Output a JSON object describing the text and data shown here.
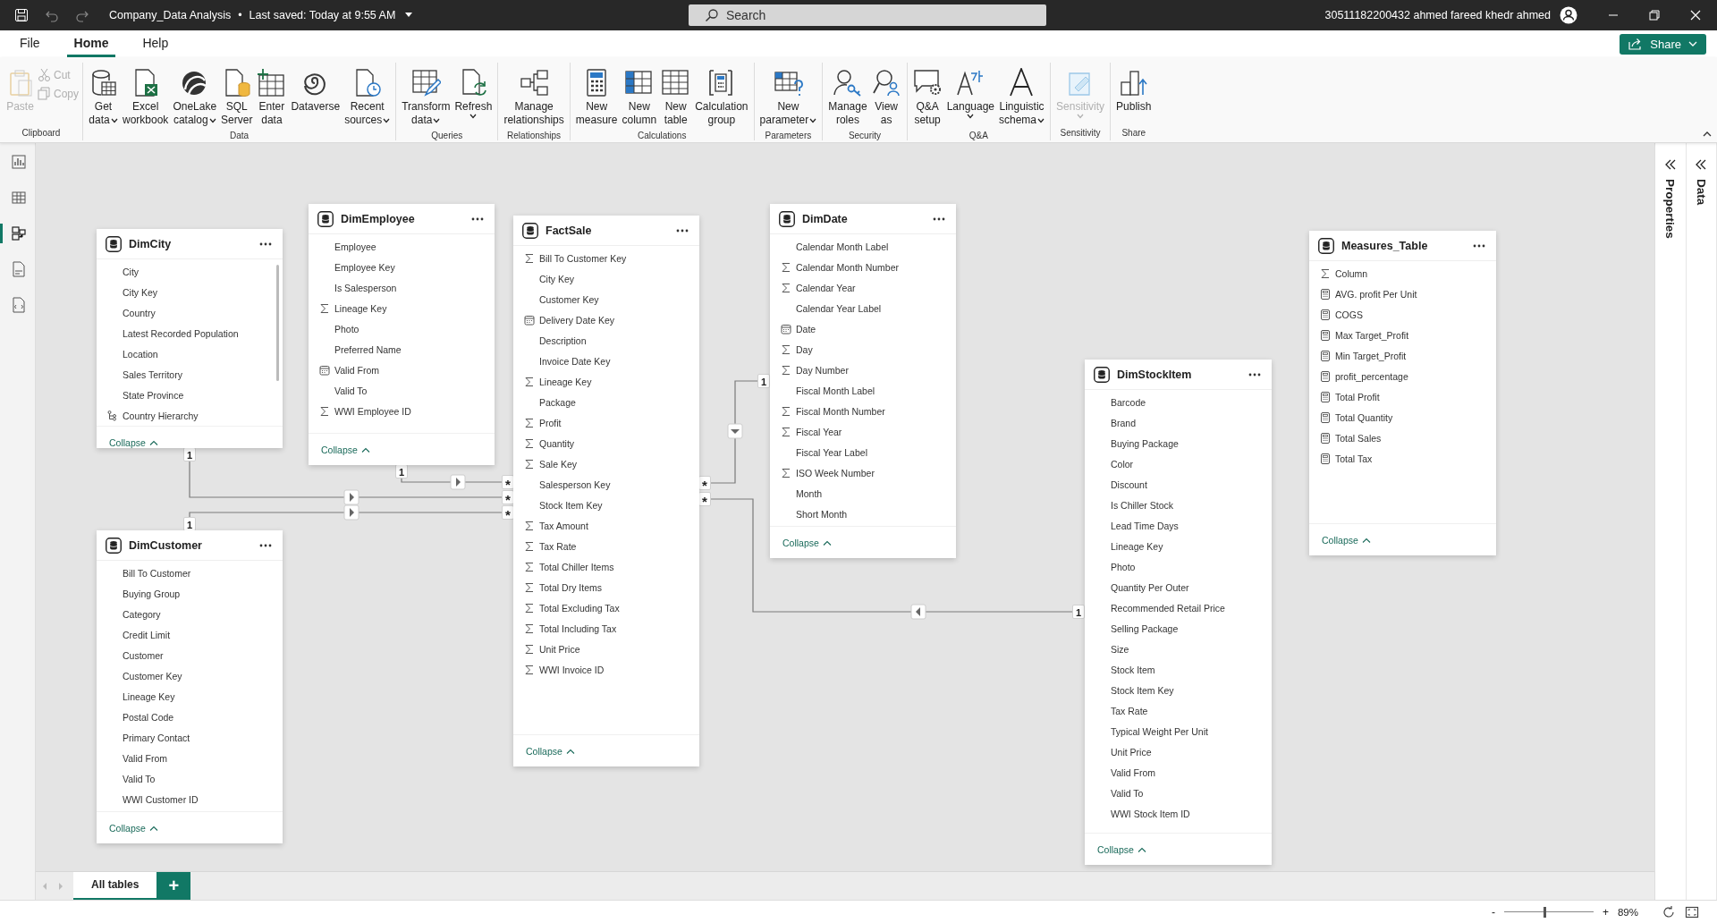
{
  "title_bar": {
    "file_name": "Company_Data Analysis",
    "separator": "•",
    "saved": "Last saved: Today at 9:55 AM",
    "search": {
      "placeholder": "Search"
    },
    "user": "30511182200432 ahmed fareed khedr ahmed"
  },
  "menu_tabs": [
    {
      "label": "File",
      "selected": false
    },
    {
      "label": "Home",
      "selected": true
    },
    {
      "label": "Help",
      "selected": false
    }
  ],
  "share_button": "Share",
  "ribbon": {
    "groups": [
      {
        "label": "Clipboard",
        "buttons": [
          {
            "lines": [
              "Paste"
            ],
            "kind": "large",
            "dropdown": false,
            "disabled": true
          },
          {
            "lines": [
              "Cut"
            ],
            "kind": "small",
            "disabled": true
          },
          {
            "lines": [
              "Copy"
            ],
            "kind": "small",
            "disabled": true
          }
        ]
      },
      {
        "label": "Data",
        "buttons": [
          {
            "lines": [
              "Get",
              "data"
            ],
            "kind": "large",
            "dropdown": true,
            "disabled": false
          },
          {
            "lines": [
              "Excel",
              "workbook"
            ],
            "kind": "large",
            "dropdown": false,
            "disabled": false
          },
          {
            "lines": [
              "OneLake",
              "catalog"
            ],
            "kind": "large",
            "dropdown": true,
            "disabled": false
          },
          {
            "lines": [
              "SQL",
              "Server"
            ],
            "kind": "large",
            "dropdown": false,
            "disabled": false
          },
          {
            "lines": [
              "Enter",
              "data"
            ],
            "kind": "large",
            "dropdown": false,
            "disabled": false
          },
          {
            "lines": [
              "Dataverse"
            ],
            "kind": "large",
            "dropdown": false,
            "disabled": false
          },
          {
            "lines": [
              "Recent",
              "sources"
            ],
            "kind": "large",
            "dropdown": true,
            "disabled": false
          }
        ]
      },
      {
        "label": "Queries",
        "buttons": [
          {
            "lines": [
              "Transform",
              "data"
            ],
            "kind": "large",
            "dropdown": true,
            "disabled": false
          },
          {
            "lines": [
              "Refresh"
            ],
            "kind": "large",
            "dropdown": true,
            "disabled": false
          }
        ]
      },
      {
        "label": "Relationships",
        "buttons": [
          {
            "lines": [
              "Manage",
              "relationships"
            ],
            "kind": "large",
            "dropdown": false,
            "disabled": false
          }
        ]
      },
      {
        "label": "Calculations",
        "buttons": [
          {
            "lines": [
              "New",
              "measure"
            ],
            "kind": "large",
            "dropdown": false,
            "disabled": false
          },
          {
            "lines": [
              "New",
              "column"
            ],
            "kind": "large",
            "dropdown": false,
            "disabled": false
          },
          {
            "lines": [
              "New",
              "table"
            ],
            "kind": "large",
            "dropdown": false,
            "disabled": false
          },
          {
            "lines": [
              "Calculation",
              "group"
            ],
            "kind": "large",
            "dropdown": false,
            "disabled": false
          }
        ]
      },
      {
        "label": "Parameters",
        "buttons": [
          {
            "lines": [
              "New",
              "parameter"
            ],
            "kind": "large",
            "dropdown": true,
            "disabled": false
          }
        ]
      },
      {
        "label": "Security",
        "buttons": [
          {
            "lines": [
              "Manage",
              "roles"
            ],
            "kind": "large",
            "dropdown": false,
            "disabled": false
          },
          {
            "lines": [
              "View",
              "as"
            ],
            "kind": "large",
            "dropdown": false,
            "disabled": false
          }
        ]
      },
      {
        "label": "Q&A",
        "buttons": [
          {
            "lines": [
              "Q&A",
              "setup"
            ],
            "kind": "large",
            "dropdown": false,
            "disabled": false
          },
          {
            "lines": [
              "Language"
            ],
            "kind": "large",
            "dropdown": true,
            "disabled": false
          },
          {
            "lines": [
              "Linguistic",
              "schema"
            ],
            "kind": "large",
            "dropdown": true,
            "disabled": false
          }
        ]
      },
      {
        "label": "Sensitivity",
        "buttons": [
          {
            "lines": [
              "Sensitivity"
            ],
            "kind": "large",
            "dropdown": true,
            "disabled": true
          }
        ]
      },
      {
        "label": "Share",
        "buttons": [
          {
            "lines": [
              "Publish"
            ],
            "kind": "large",
            "dropdown": false,
            "disabled": false
          }
        ]
      }
    ]
  },
  "view_rail": [
    {
      "selected": false
    },
    {
      "selected": false
    },
    {
      "selected": true
    },
    {
      "selected": false
    },
    {
      "selected": false
    }
  ],
  "side_panes": [
    {
      "label": "Properties"
    },
    {
      "label": "Data"
    }
  ],
  "tables": [
    {
      "name": "DimCity",
      "scrollbar": true,
      "collapse": "Collapse",
      "fields": [
        {
          "name": "City",
          "kind": "text"
        },
        {
          "name": "City Key",
          "kind": "text"
        },
        {
          "name": "Country",
          "kind": "text"
        },
        {
          "name": "Latest Recorded Population",
          "kind": "text"
        },
        {
          "name": "Location",
          "kind": "text"
        },
        {
          "name": "Sales Territory",
          "kind": "text"
        },
        {
          "name": "State Province",
          "kind": "text"
        },
        {
          "name": "Country Hierarchy",
          "kind": "hierarchy"
        }
      ]
    },
    {
      "name": "DimEmployee",
      "scrollbar": false,
      "collapse": "Collapse",
      "fields": [
        {
          "name": "Employee",
          "kind": "text"
        },
        {
          "name": "Employee Key",
          "kind": "text"
        },
        {
          "name": "Is Salesperson",
          "kind": "text"
        },
        {
          "name": "Lineage Key",
          "kind": "sum"
        },
        {
          "name": "Photo",
          "kind": "text"
        },
        {
          "name": "Preferred Name",
          "kind": "text"
        },
        {
          "name": "Valid From",
          "kind": "date"
        },
        {
          "name": "Valid To",
          "kind": "text"
        },
        {
          "name": "WWI Employee ID",
          "kind": "sum"
        }
      ]
    },
    {
      "name": "DimCustomer",
      "scrollbar": false,
      "collapse": "Collapse",
      "fields": [
        {
          "name": "Bill To Customer",
          "kind": "text"
        },
        {
          "name": "Buying Group",
          "kind": "text"
        },
        {
          "name": "Category",
          "kind": "text"
        },
        {
          "name": "Credit Limit",
          "kind": "text"
        },
        {
          "name": "Customer",
          "kind": "text"
        },
        {
          "name": "Customer Key",
          "kind": "text"
        },
        {
          "name": "Lineage Key",
          "kind": "text"
        },
        {
          "name": "Postal Code",
          "kind": "text"
        },
        {
          "name": "Primary Contact",
          "kind": "text"
        },
        {
          "name": "Valid From",
          "kind": "text"
        },
        {
          "name": "Valid To",
          "kind": "text"
        },
        {
          "name": "WWI Customer ID",
          "kind": "text"
        }
      ]
    },
    {
      "name": "FactSale",
      "scrollbar": false,
      "collapse": "Collapse",
      "fields": [
        {
          "name": "Bill To Customer Key",
          "kind": "sum"
        },
        {
          "name": "City Key",
          "kind": "text"
        },
        {
          "name": "Customer Key",
          "kind": "text"
        },
        {
          "name": "Delivery Date Key",
          "kind": "date"
        },
        {
          "name": "Description",
          "kind": "text"
        },
        {
          "name": "Invoice Date Key",
          "kind": "text"
        },
        {
          "name": "Lineage Key",
          "kind": "sum"
        },
        {
          "name": "Package",
          "kind": "text"
        },
        {
          "name": "Profit",
          "kind": "sum"
        },
        {
          "name": "Quantity",
          "kind": "sum"
        },
        {
          "name": "Sale Key",
          "kind": "sum"
        },
        {
          "name": "Salesperson Key",
          "kind": "text"
        },
        {
          "name": "Stock Item Key",
          "kind": "text"
        },
        {
          "name": "Tax Amount",
          "kind": "sum"
        },
        {
          "name": "Tax Rate",
          "kind": "sum"
        },
        {
          "name": "Total Chiller Items",
          "kind": "sum"
        },
        {
          "name": "Total Dry Items",
          "kind": "sum"
        },
        {
          "name": "Total Excluding Tax",
          "kind": "sum"
        },
        {
          "name": "Total Including Tax",
          "kind": "sum"
        },
        {
          "name": "Unit Price",
          "kind": "sum"
        },
        {
          "name": "WWI Invoice ID",
          "kind": "sum"
        }
      ]
    },
    {
      "name": "DimDate",
      "scrollbar": false,
      "collapse": "Collapse",
      "fields": [
        {
          "name": "Calendar Month Label",
          "kind": "text"
        },
        {
          "name": "Calendar Month Number",
          "kind": "sum"
        },
        {
          "name": "Calendar Year",
          "kind": "sum"
        },
        {
          "name": "Calendar Year Label",
          "kind": "text"
        },
        {
          "name": "Date",
          "kind": "date"
        },
        {
          "name": "Day",
          "kind": "sum"
        },
        {
          "name": "Day Number",
          "kind": "sum"
        },
        {
          "name": "Fiscal Month Label",
          "kind": "text"
        },
        {
          "name": "Fiscal Month Number",
          "kind": "sum"
        },
        {
          "name": "Fiscal Year",
          "kind": "sum"
        },
        {
          "name": "Fiscal Year Label",
          "kind": "text"
        },
        {
          "name": "ISO Week Number",
          "kind": "sum"
        },
        {
          "name": "Month",
          "kind": "text"
        },
        {
          "name": "Short Month",
          "kind": "text"
        }
      ]
    },
    {
      "name": "DimStockItem",
      "scrollbar": false,
      "collapse": "Collapse",
      "fields": [
        {
          "name": "Barcode",
          "kind": "text"
        },
        {
          "name": "Brand",
          "kind": "text"
        },
        {
          "name": "Buying Package",
          "kind": "text"
        },
        {
          "name": "Color",
          "kind": "text"
        },
        {
          "name": "Discount",
          "kind": "text"
        },
        {
          "name": "Is Chiller Stock",
          "kind": "text"
        },
        {
          "name": "Lead Time Days",
          "kind": "text"
        },
        {
          "name": "Lineage Key",
          "kind": "text"
        },
        {
          "name": "Photo",
          "kind": "text"
        },
        {
          "name": "Quantity Per Outer",
          "kind": "text"
        },
        {
          "name": "Recommended Retail Price",
          "kind": "text"
        },
        {
          "name": "Selling Package",
          "kind": "text"
        },
        {
          "name": "Size",
          "kind": "text"
        },
        {
          "name": "Stock Item",
          "kind": "text"
        },
        {
          "name": "Stock Item Key",
          "kind": "text"
        },
        {
          "name": "Tax Rate",
          "kind": "text"
        },
        {
          "name": "Typical Weight Per Unit",
          "kind": "text"
        },
        {
          "name": "Unit Price",
          "kind": "text"
        },
        {
          "name": "Valid From",
          "kind": "text"
        },
        {
          "name": "Valid To",
          "kind": "text"
        },
        {
          "name": "WWI Stock Item ID",
          "kind": "text"
        }
      ]
    },
    {
      "name": "Measures_Table",
      "scrollbar": false,
      "collapse": "Collapse",
      "fields": [
        {
          "name": "Column",
          "kind": "sum"
        },
        {
          "name": "AVG. profit Per Unit",
          "kind": "measure"
        },
        {
          "name": "COGS",
          "kind": "measure"
        },
        {
          "name": "Max Target_Profit",
          "kind": "measure"
        },
        {
          "name": "Min Target_Profit",
          "kind": "measure"
        },
        {
          "name": "profit_percentage",
          "kind": "measure"
        },
        {
          "name": "Total Profit",
          "kind": "measure"
        },
        {
          "name": "Total Quantity",
          "kind": "measure"
        },
        {
          "name": "Total Sales",
          "kind": "measure"
        },
        {
          "name": "Total Tax",
          "kind": "measure"
        }
      ]
    }
  ],
  "relationships": [
    {
      "one_end": "1",
      "many_end": "*"
    },
    {
      "one_end": "1",
      "many_end": "*"
    },
    {
      "one_end": "1",
      "many_end": "*"
    },
    {
      "one_end": "1",
      "many_end": "*"
    },
    {
      "one_end": "1",
      "many_end": "*"
    }
  ],
  "page_tabs": [
    {
      "label": "All tables",
      "selected": true
    }
  ],
  "add_tab": "+",
  "status_bar": {
    "zoom_out": "-",
    "zoom_in": "+",
    "zoom": {
      "level": 0.45
    },
    "zoom_reading": "89%"
  }
}
